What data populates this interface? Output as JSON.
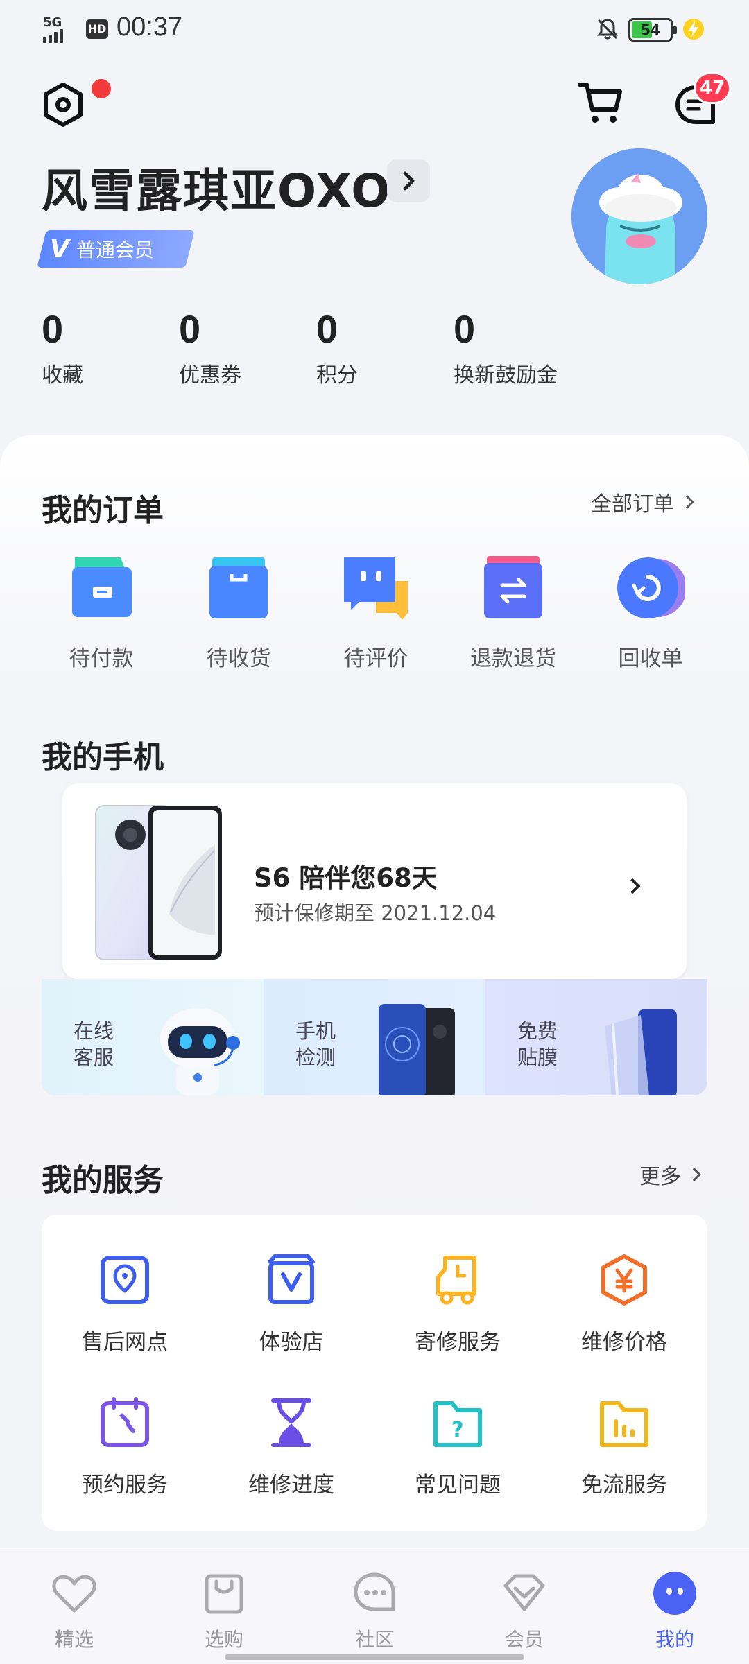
{
  "status_bar": {
    "network": "5G",
    "hd": "HD",
    "time": "00:37",
    "battery": "54",
    "battery_level": 0.54
  },
  "header": {
    "message_badge": "47",
    "username": "风雪露琪亚OXO",
    "member_v": "V",
    "member_level": "普通会员"
  },
  "stats": [
    {
      "value": "0",
      "label": "收藏"
    },
    {
      "value": "0",
      "label": "优惠券"
    },
    {
      "value": "0",
      "label": "积分"
    },
    {
      "value": "0",
      "label": "换新鼓励金"
    }
  ],
  "orders": {
    "title": "我的订单",
    "all_label": "全部订单",
    "items": [
      {
        "label": "待付款",
        "icon": "wallet-icon"
      },
      {
        "label": "待收货",
        "icon": "shopping-bag-icon"
      },
      {
        "label": "待评价",
        "icon": "chat-bubbles-icon"
      },
      {
        "label": "退款退货",
        "icon": "exchange-icon"
      },
      {
        "label": "回收单",
        "icon": "recycle-icon"
      }
    ]
  },
  "my_phone": {
    "title": "我的手机",
    "phone_title": "S6 陪伴您68天",
    "phone_subtitle": "预计保修期至 2021.12.04",
    "quick": [
      {
        "line1": "在线",
        "line2": "客服"
      },
      {
        "line1": "手机",
        "line2": "检测"
      },
      {
        "line1": "免费",
        "line2": "贴膜"
      }
    ]
  },
  "services": {
    "title": "我的服务",
    "more_label": "更多",
    "items": [
      {
        "label": "售后网点",
        "icon": "location-pin-icon"
      },
      {
        "label": "体验店",
        "icon": "store-icon"
      },
      {
        "label": "寄修服务",
        "icon": "delivery-truck-icon"
      },
      {
        "label": "维修价格",
        "icon": "price-yen-icon"
      },
      {
        "label": "预约服务",
        "icon": "calendar-wrench-icon"
      },
      {
        "label": "维修进度",
        "icon": "hourglass-icon"
      },
      {
        "label": "常见问题",
        "icon": "question-folder-icon"
      },
      {
        "label": "免流服务",
        "icon": "data-chart-icon"
      }
    ]
  },
  "bottom_nav": [
    {
      "label": "精选",
      "icon": "heart-icon"
    },
    {
      "label": "选购",
      "icon": "bag-icon"
    },
    {
      "label": "社区",
      "icon": "chat-icon"
    },
    {
      "label": "会员",
      "icon": "diamond-icon"
    },
    {
      "label": "我的",
      "icon": "profile-face-icon",
      "active": true
    }
  ],
  "colors": {
    "accent": "#4a63f5",
    "badge": "#ff3b53",
    "notification_dot": "#f23a3a",
    "member_tag": "#6b8fff"
  }
}
